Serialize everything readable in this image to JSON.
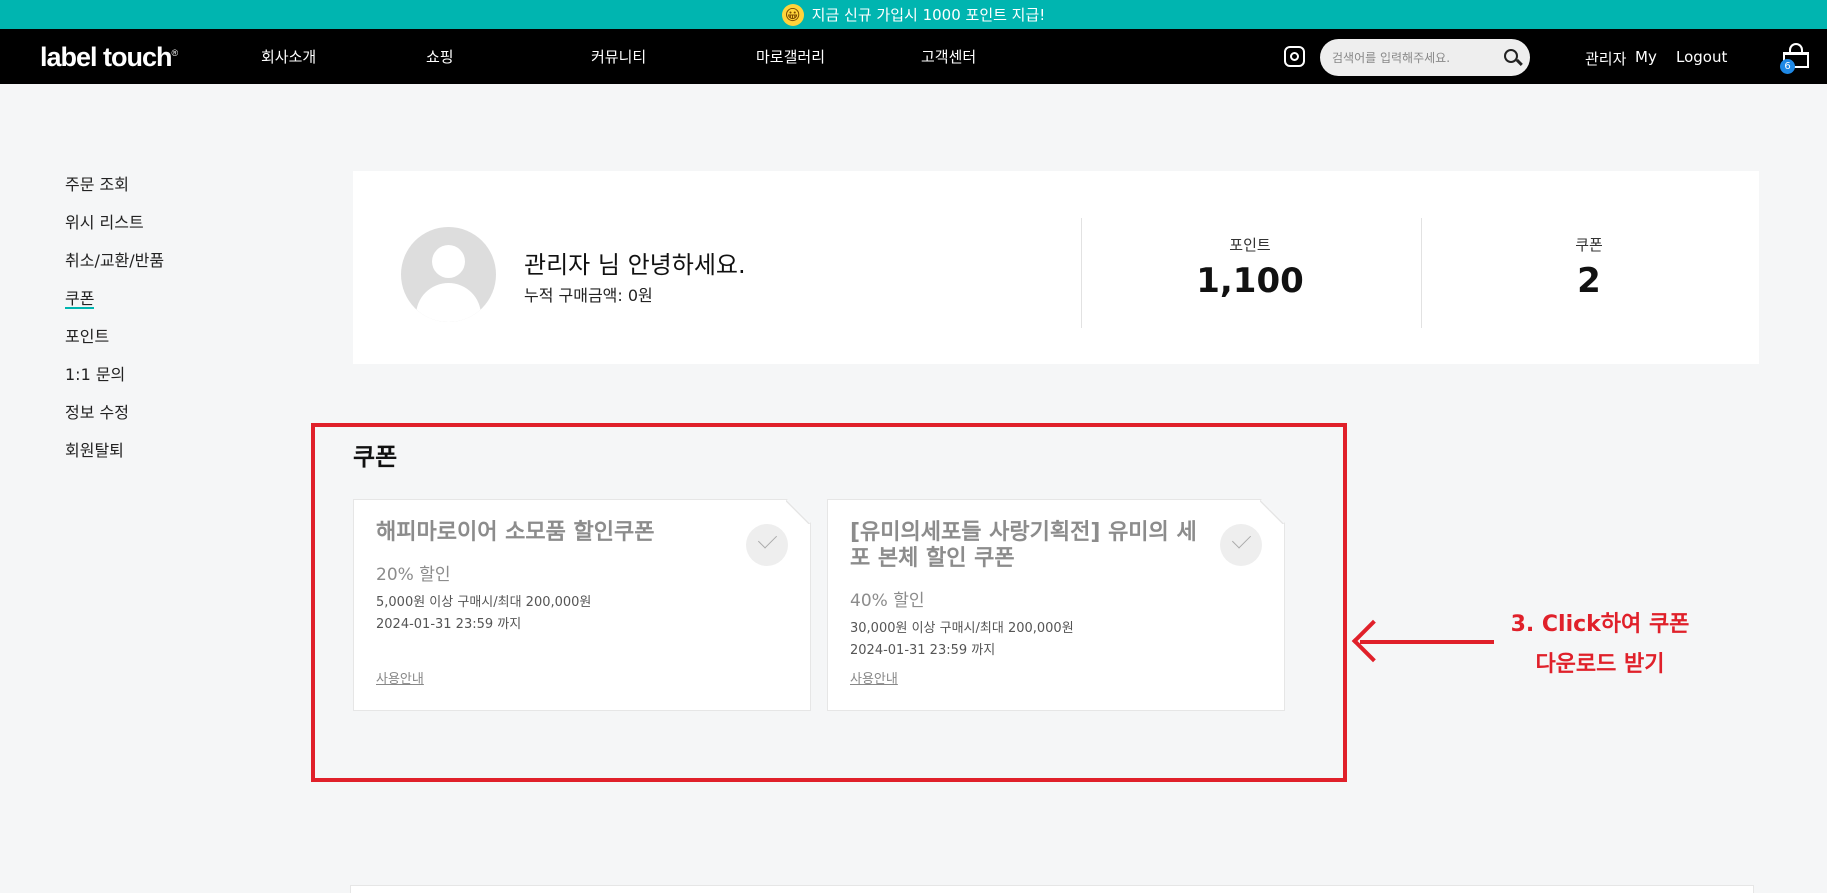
{
  "banner": {
    "emoji": "😀",
    "text": "지금 신규 가입시 1000 포인트 지급!"
  },
  "header": {
    "logo": "label touch",
    "logo_mark": "®",
    "menu": [
      "회사소개",
      "쇼핑",
      "커뮤니티",
      "마로갤러리",
      "고객센터"
    ],
    "search_placeholder": "검색어를 입력해주세요.",
    "user_name": "관리자",
    "my": "My",
    "logout": "Logout",
    "cart_count": "6"
  },
  "sidebar": {
    "items": [
      "주문 조회",
      "위시 리스트",
      "취소/교환/반품",
      "쿠폰",
      "포인트",
      "1:1 문의",
      "정보 수정",
      "회원탈퇴"
    ],
    "active_index": 3
  },
  "profile": {
    "greeting": "관리자 님 안녕하세요.",
    "total_purchase": "누적 구매금액: 0원",
    "point_label": "포인트",
    "point_value": "1,100",
    "coupon_label": "쿠폰",
    "coupon_value": "2"
  },
  "coupon_section": {
    "title": "쿠폰",
    "coupons": [
      {
        "name": "해피마로이어 소모품 할인쿠폰",
        "discount": "20% 할인",
        "condition": "5,000원 이상 구매시/최대 200,000원",
        "expiry": "2024-01-31 23:59 까지",
        "guide": "사용안내"
      },
      {
        "name": "[유미의세포들 사랑기획전] 유미의 세포 본체 할인 쿠폰",
        "discount": "40% 할인",
        "condition": "30,000원 이상 구매시/최대 200,000원",
        "expiry": "2024-01-31 23:59 까지",
        "guide": "사용안내"
      }
    ]
  },
  "annotation": {
    "line1": "3. Click하여 쿠폰",
    "line2": "다운로드 받기",
    "color": "#e0202a"
  }
}
